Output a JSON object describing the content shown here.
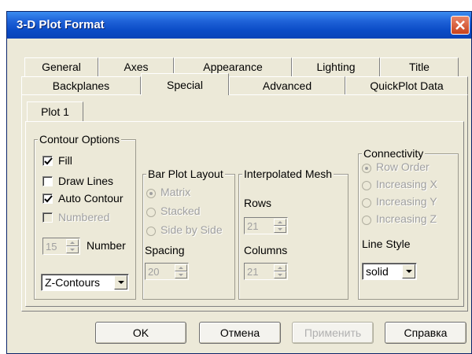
{
  "window": {
    "title": "3-D Plot Format"
  },
  "tabs_row1": [
    {
      "label": "General"
    },
    {
      "label": "Axes"
    },
    {
      "label": "Appearance"
    },
    {
      "label": "Lighting"
    },
    {
      "label": "Title"
    }
  ],
  "tabs_row2": [
    {
      "label": "Backplanes"
    },
    {
      "label": "Special"
    },
    {
      "label": "Advanced"
    },
    {
      "label": "QuickPlot Data"
    }
  ],
  "inner_tab": {
    "label": "Plot 1"
  },
  "contour": {
    "legend": "Contour Options",
    "fill": {
      "label": "Fill",
      "checked": true
    },
    "draw_lines": {
      "label": "Draw Lines",
      "checked": false
    },
    "auto_contour": {
      "label": "Auto Contour",
      "checked": true
    },
    "numbered": {
      "label": "Numbered",
      "checked": false,
      "disabled": true
    },
    "number": {
      "label": "Number",
      "value": "15"
    },
    "type": {
      "value": "Z-Contours"
    }
  },
  "bar_layout": {
    "legend": "Bar Plot Layout",
    "options": [
      {
        "label": "Matrix",
        "selected": true
      },
      {
        "label": "Stacked",
        "selected": false
      },
      {
        "label": "Side by Side",
        "selected": false
      }
    ],
    "spacing": {
      "label": "Spacing",
      "value": "20"
    }
  },
  "interp": {
    "legend": "Interpolated Mesh",
    "rows": {
      "label": "Rows",
      "value": "21"
    },
    "columns": {
      "label": "Columns",
      "value": "21"
    }
  },
  "connectivity": {
    "legend": "Connectivity",
    "options": [
      {
        "label": "Row Order",
        "selected": true
      },
      {
        "label": "Increasing X",
        "selected": false
      },
      {
        "label": "Increasing Y",
        "selected": false
      },
      {
        "label": "Increasing Z",
        "selected": false
      }
    ],
    "line_style": {
      "label": "Line Style",
      "value": "solid"
    }
  },
  "buttons": {
    "ok": "OK",
    "cancel": "Отмена",
    "apply": "Применить",
    "help": "Справка"
  }
}
